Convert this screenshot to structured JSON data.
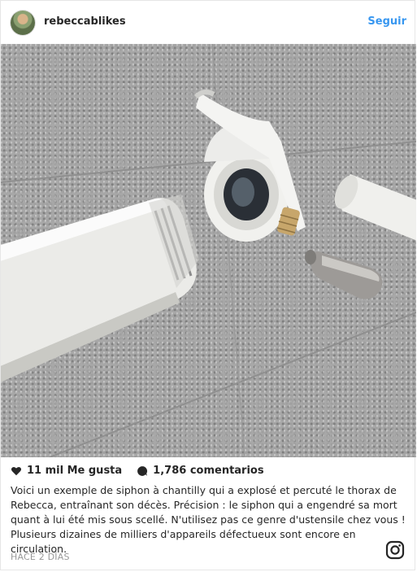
{
  "post": {
    "username": "rebeccablikes",
    "follow_label": "Seguir",
    "likes": "11 mil Me gusta",
    "comments": "1,786 comentarios",
    "caption": "Voici un exemple de siphon à chantilly qui a explosé et percuté le thorax de Rebecca, entraînant son décès. Précision : le siphon qui a engendré sa mort quant à lui été mis sous scellé. N'utilisez pas ce genre d'ustensile chez vous ! Plusieurs dizaines de milliers d'appareils défectueux sont encore en circulation.",
    "timestamp": "HACE 2 DÍAS"
  },
  "icons": {
    "like": "heart-icon",
    "comment": "comment-bubble-icon",
    "brand": "instagram-logo-icon"
  },
  "colors": {
    "follow": "#3897f0",
    "text": "#262626",
    "muted": "#999999"
  }
}
